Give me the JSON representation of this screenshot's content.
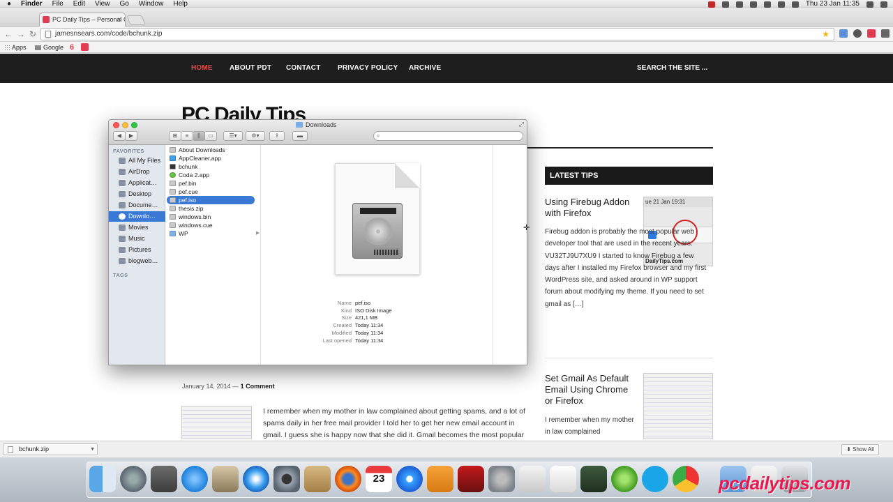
{
  "menubar": {
    "apple": "",
    "items": [
      "Finder",
      "File",
      "Edit",
      "View",
      "Go",
      "Window",
      "Help"
    ],
    "clock": "Thu 23 Jan  11:35"
  },
  "browser": {
    "tab_title": "PC Daily Tips – Personal C",
    "tab_close": "×",
    "url": "jamesnsears.com/code/bchunk.zip",
    "bookmarks": {
      "apps": "Apps",
      "google": "Google",
      "six": "6"
    }
  },
  "site": {
    "nav": [
      "HOME",
      "ABOUT PDT",
      "CONTACT",
      "PRIVACY POLICY",
      "ARCHIVE"
    ],
    "search": "SEARCH THE SITE ...",
    "title": "PC Daily Tips",
    "latest_tips": "LATEST TIPS",
    "post1": {
      "title": "Using Firebug Addon with Firefox",
      "thumb_bar": "ue 21 Jan  19:31",
      "thumb_caption": "DailyTips.com",
      "body": "Firebug addon is probably the most popular web developer tool that are used in the recent years. VU32TJ9U7XU9 I started to know Firebug a few days after I installed my Firefox browser and my first WordPress site, and asked around in WP support forum about modifying my theme. If you need to set gmail as […]"
    },
    "post2": {
      "title": "Set Gmail As Default Email Using Chrome or Firefox",
      "body": "I remember when my mother in law complained"
    },
    "article": {
      "date": "January 14, 2014",
      "dash": "—",
      "comments": "1 Comment",
      "text": "I remember when my mother in law complained about getting spams, and a lot of spams daily in her free mail provider I told her to get her new email account in gmail. I guess she is happy now that she did it. Gmail becomes the most popular"
    }
  },
  "finder": {
    "title": "Downloads",
    "sidebar": {
      "favorites_label": "FAVORITES",
      "tags_label": "TAGS",
      "items": [
        "All My Files",
        "AirDrop",
        "Applicat…",
        "Desktop",
        "Docume…",
        "Downlo…",
        "Movies",
        "Music",
        "Pictures",
        "blogweb…"
      ],
      "selected_index": 5
    },
    "files": [
      "About Downloads",
      "AppCleaner.app",
      "bchunk",
      "Coda 2.app",
      "pef.bin",
      "pef.cue",
      "pef.iso",
      "thesis.zip",
      "windows.bin",
      "windows.cue",
      "WP"
    ],
    "selected_file_index": 6,
    "info": {
      "name_label": "Name",
      "name": "pef.iso",
      "kind_label": "Kind",
      "kind": "ISO Disk Image",
      "size_label": "Size",
      "size": "421,1 MB",
      "created_label": "Created",
      "created": "Today 11:34",
      "modified_label": "Modified",
      "modified": "Today 11:34",
      "opened_label": "Last opened",
      "opened": "Today 11:34"
    }
  },
  "downloads_bar": {
    "file": "bchunk.zip",
    "show_all": "Show All"
  },
  "dock": {
    "calendar_day": "23",
    "watermark": "pcdailytips.com"
  },
  "colors": {
    "accent_red": "#e24a4a",
    "selection_blue": "#3a78d6",
    "nav_bg": "#1e1e1e",
    "watermark": "#e8194e"
  }
}
